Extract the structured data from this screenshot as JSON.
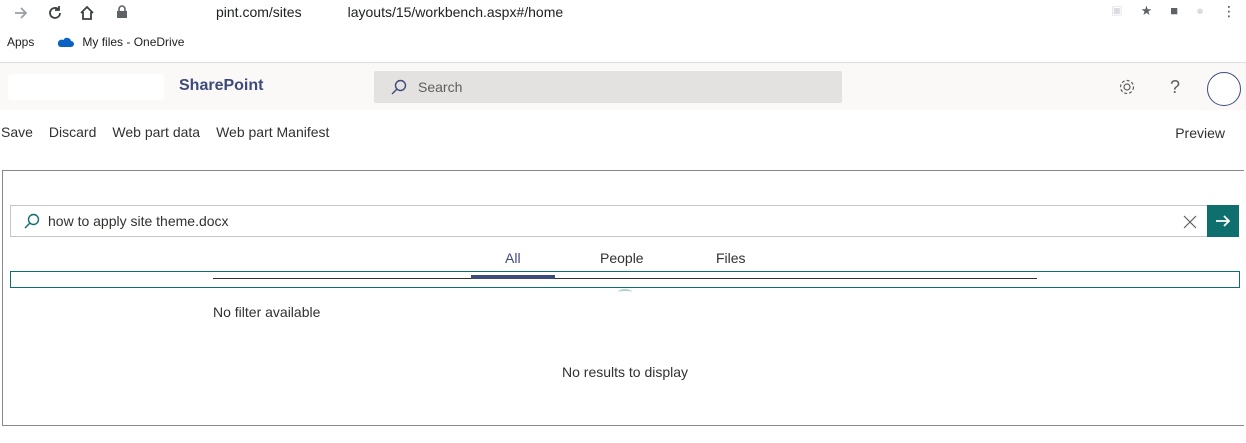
{
  "browser": {
    "url_part1": "pint.com/sites",
    "url_part2": "layouts/15/workbench.aspx#/home",
    "bookmarks": [
      {
        "label": "Apps"
      },
      {
        "label": "My files - OneDrive"
      }
    ]
  },
  "header": {
    "brand": "SharePoint",
    "search_placeholder": "Search"
  },
  "commandbar": {
    "items": [
      "Save",
      "Discard",
      "Web part data",
      "Web part Manifest"
    ],
    "preview": "Preview"
  },
  "webpart": {
    "query": "how to apply site theme.docx",
    "tabs": [
      {
        "label": "All",
        "active": true
      },
      {
        "label": "People",
        "active": false
      },
      {
        "label": "Files",
        "active": false
      }
    ],
    "no_filter": "No filter available",
    "no_results": "No results to display"
  },
  "colors": {
    "brand": "#3e4a7a",
    "accent": "#0f6f6e",
    "header_bg": "#faf9f8",
    "search_bg": "#e3e2e1"
  },
  "icons": {
    "back": "arrow-right-icon",
    "reload": "reload-icon",
    "home": "home-icon",
    "lock": "lock-icon",
    "settings": "gear-icon",
    "help": "help-icon",
    "search": "search-icon",
    "clear": "close-icon",
    "go": "arrow-right-icon"
  }
}
